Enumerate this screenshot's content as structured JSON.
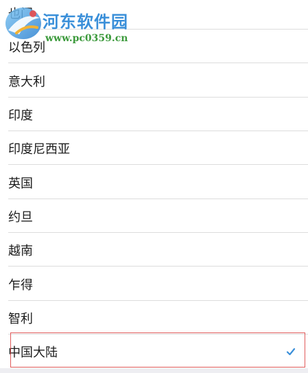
{
  "watermark": {
    "title": "河东软件园",
    "url": "www.pc0359.cn"
  },
  "countries": [
    {
      "label": "也门"
    },
    {
      "label": "以色列"
    },
    {
      "label": "意大利"
    },
    {
      "label": "印度"
    },
    {
      "label": "印度尼西亚"
    },
    {
      "label": "英国"
    },
    {
      "label": "约旦"
    },
    {
      "label": "越南"
    },
    {
      "label": "乍得"
    },
    {
      "label": "智利"
    },
    {
      "label": "中国大陆",
      "selected": true
    }
  ],
  "colors": {
    "highlight": "#e05a5a",
    "check": "#3a8fd9",
    "divider": "#dcdcdc"
  }
}
